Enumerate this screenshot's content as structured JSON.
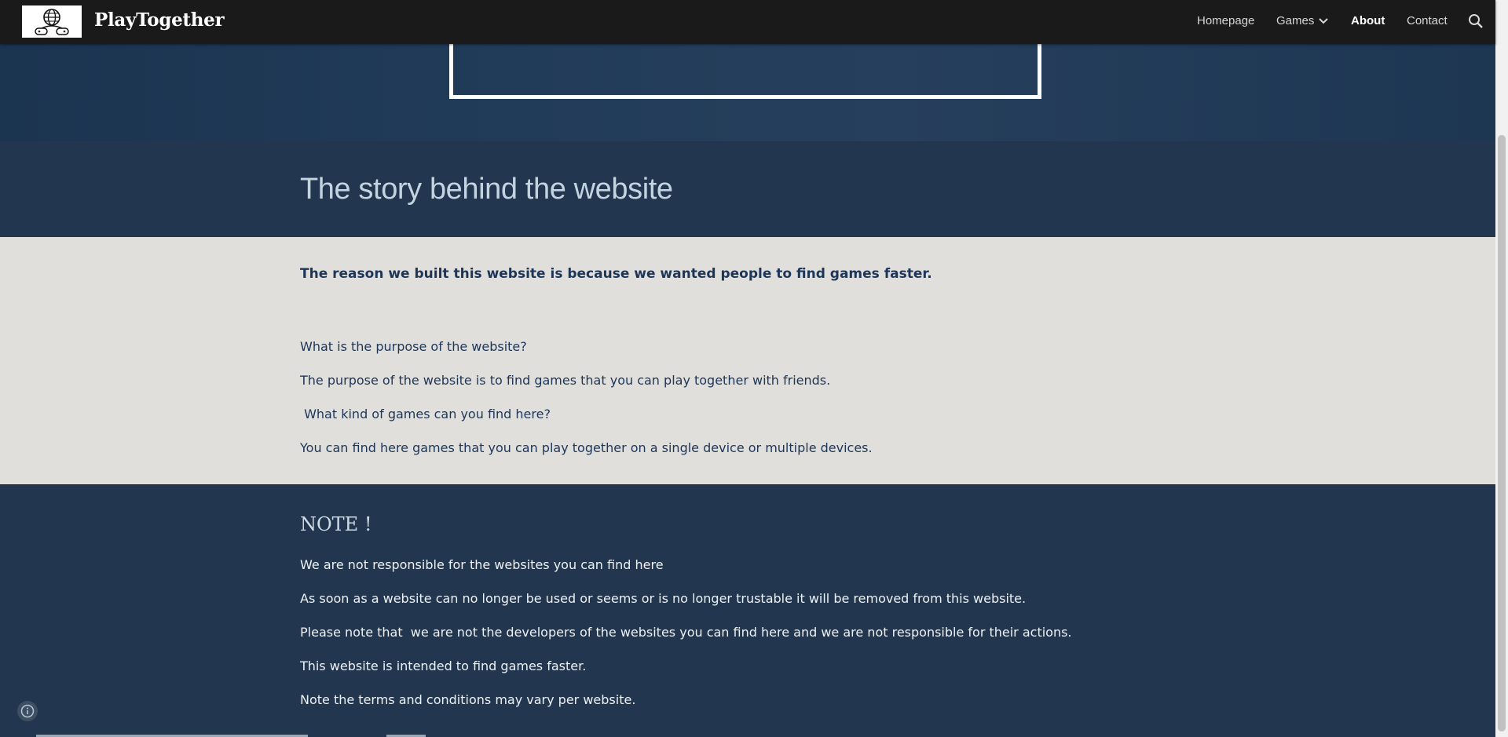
{
  "header": {
    "site_title": "PlayTogether",
    "nav": {
      "homepage": "Homepage",
      "games": "Games",
      "about": "About",
      "contact": "Contact"
    }
  },
  "story": {
    "title": "The story behind the website"
  },
  "about": {
    "lead": "The reason we built this website is because we wanted people to find games faster.",
    "q1": "What is the purpose of the website?",
    "a1": "The purpose of the website is to find games that you can play together with friends.",
    "q2": " What kind of games can you find here?",
    "a2": "You can find here games that you can play together on a single device or multiple devices."
  },
  "note": {
    "title": "NOTE !",
    "lines": [
      "We are not responsible for the websites you can find here",
      "As soon as a website can no longer be used or seems or is no longer trustable it will be removed from this website.",
      "Please note that  we are not the developers of the websites you can find here and we are not responsible for their actions.",
      "This website is intended to find games faster.",
      "Note the terms and conditions may vary per website."
    ]
  },
  "colors": {
    "topbar": "#1a1a1a",
    "dark_section": "#22374f",
    "light_section": "#e0dfdc",
    "heading": "#c4d3e0"
  },
  "icons": {
    "logo": "globe-gamepad-logo",
    "games_dropdown": "chevron-down-icon",
    "search": "search-icon",
    "info": "info-icon"
  }
}
